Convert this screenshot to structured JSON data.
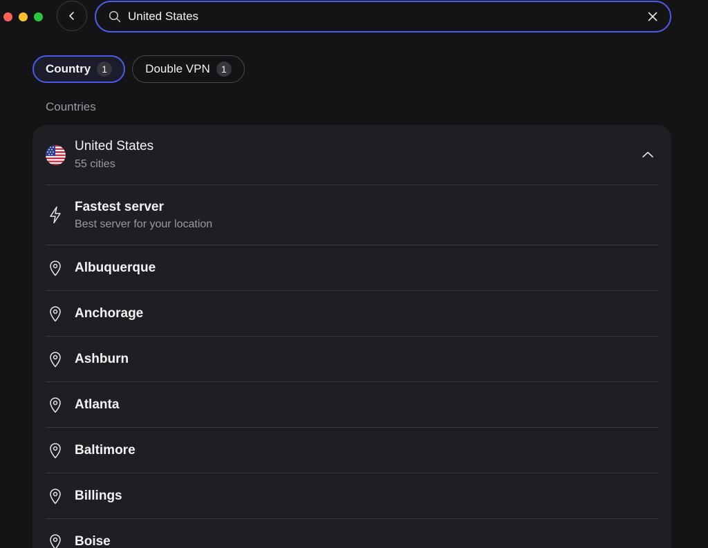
{
  "search": {
    "value": "United States",
    "placeholder": ""
  },
  "filters": [
    {
      "label": "Country",
      "count": "1",
      "active": true
    },
    {
      "label": "Double VPN",
      "count": "1",
      "active": false
    }
  ],
  "section_label": "Countries",
  "country": {
    "name": "United States",
    "subtitle": "55 cities",
    "flag_icon": "us-flag-icon",
    "expanded": true
  },
  "fastest": {
    "title": "Fastest server",
    "subtitle": "Best server for your location",
    "icon": "lightning-icon"
  },
  "cities": [
    {
      "name": "Albuquerque"
    },
    {
      "name": "Anchorage"
    },
    {
      "name": "Ashburn"
    },
    {
      "name": "Atlanta"
    },
    {
      "name": "Baltimore"
    },
    {
      "name": "Billings"
    },
    {
      "name": "Boise"
    }
  ],
  "colors": {
    "accent": "#4a5cf0",
    "background": "#141416",
    "panel": "#1e1f22"
  }
}
